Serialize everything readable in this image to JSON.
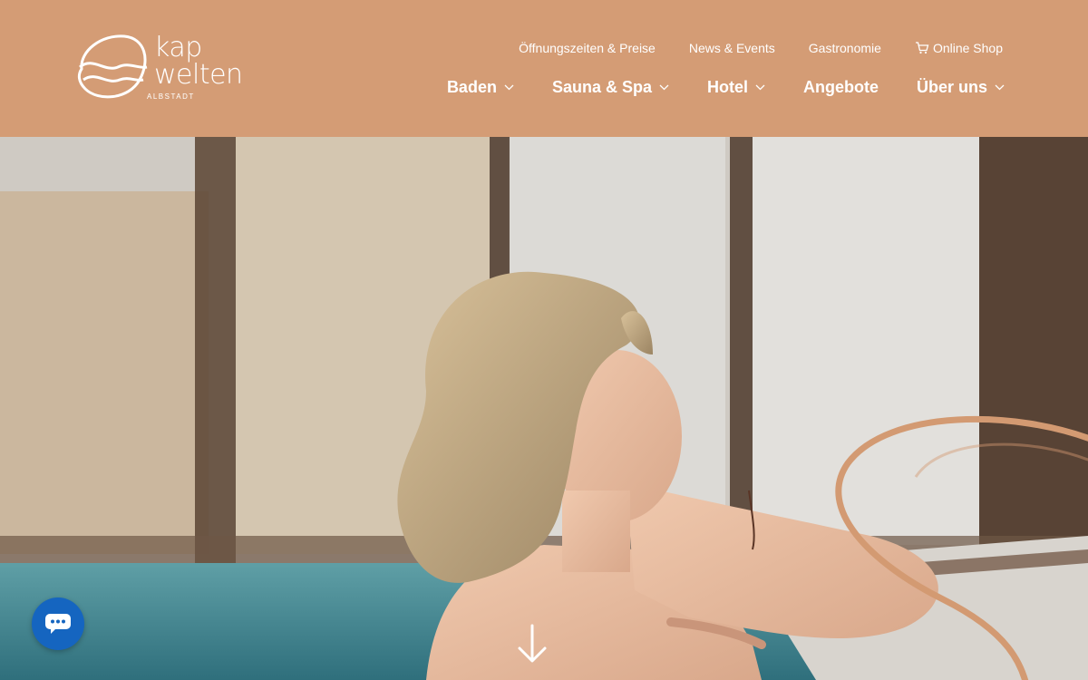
{
  "brand": {
    "name_line1": "kap",
    "name_line2": "welten",
    "location": "ALBSTADT"
  },
  "top_nav": [
    {
      "label": "Öffnungszeiten & Preise"
    },
    {
      "label": "News & Events"
    },
    {
      "label": "Gastronomie"
    },
    {
      "label": "Online Shop",
      "icon": "cart-icon"
    }
  ],
  "main_nav": [
    {
      "label": "Baden",
      "has_dropdown": true
    },
    {
      "label": "Sauna & Spa",
      "has_dropdown": true
    },
    {
      "label": "Hotel",
      "has_dropdown": true
    },
    {
      "label": "Angebote",
      "has_dropdown": false
    },
    {
      "label": "Über uns",
      "has_dropdown": true
    }
  ],
  "hero": {
    "image": "woman relaxing at the edge of an indoor pool with winter forest behind windows",
    "scroll_icon": "arrow-down-icon"
  },
  "chat": {
    "icon": "chat-bubble-icon"
  },
  "colors": {
    "header_bg": "#d49c75",
    "accent_curve": "#d39a72",
    "chat_bg": "#1565c0",
    "text": "#ffffff"
  }
}
